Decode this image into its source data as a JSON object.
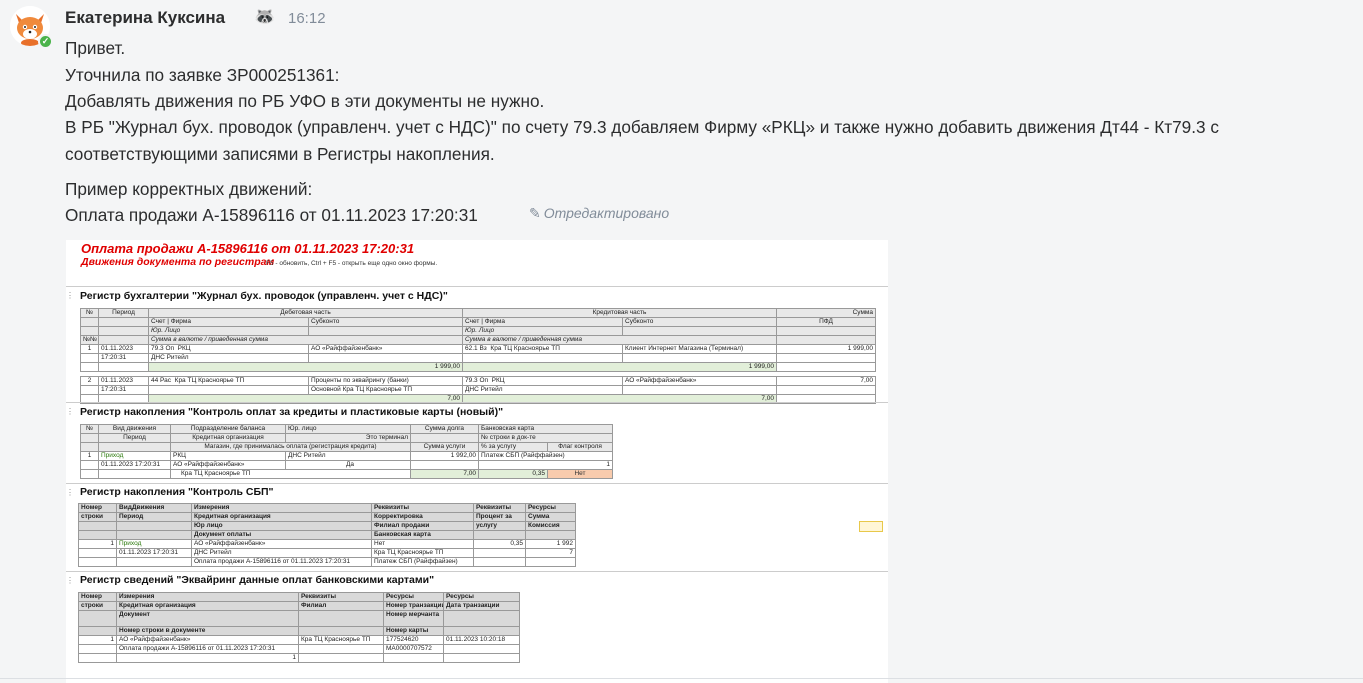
{
  "message": {
    "author": "Екатерина Куксина",
    "author_emoji": "🦝",
    "time": "16:12",
    "lines": [
      "Привет.",
      "Уточнила по заявке ЗР000251361:",
      "Добавлять движения по РБ УФО в эти документы не нужно.",
      "В РБ \"Журнал бух. проводок (управленч. учет с НДС)\"  по счету 79.3 добавляем Фирму «РКЦ»  и также нужно добавить движения Дт44 - Кт79.3 с",
      "соответствующими записями в Регистры накопления.",
      "Пример корректных движений:",
      "Оплата продажи А-15896116 от 01.11.2023 17:20:31"
    ],
    "edited": "Отредактировано",
    "edited_icon": "pencil-icon"
  },
  "screenshot": {
    "title": "Оплата продажи А-15896116 от 01.11.2023 17:20:31",
    "subtitle": "Движения документа по регистрам",
    "hint": "F5 - обновить, Ctrl + F5 - открыть еще одно окно формы.",
    "reg1": {
      "title": "Регистр бухгалтерии \"Журнал бух. проводок (управленч. учет с НДС)\"",
      "h_num": "№",
      "h_period": "Период",
      "h_debit": "Дебетовая часть",
      "h_credit": "Кредитовая часть",
      "h_sum": "Сумма",
      "h_acc": "Счет",
      "h_firm": "Фирма",
      "h_subk": "Субконто",
      "h_pfd": "ПФД",
      "h_ul": "Юр. Лицо",
      "h_nn": "№№",
      "h_cur": "Сумма в валюте / приведенная сумма",
      "rows": [
        {
          "n": "1",
          "date": "01.11.2023",
          "time": "17:20:31",
          "d_acc": "79.3 Оп",
          "d_firm": "РКЦ",
          "d_ul": "ДНС Ритейл",
          "d_subk": "АО «Райффайзенбанк»",
          "d_sum": "1 999,00",
          "c_acc": "62.1 Вз",
          "c_firm": "Кра ТЦ Красноярье ТП",
          "c_ul": "",
          "c_subk": "Клиент Интернет Магазина (Терминал)",
          "c_sum": "1 999,00",
          "sum": "1 999,00",
          "d_subk2": "",
          "c_subk2": ""
        },
        {
          "n": "2",
          "date": "01.11.2023",
          "time": "17:20:31",
          "d_acc": "44 Рас",
          "d_firm": "Кра ТЦ Красноярье ТП",
          "d_ul": "",
          "d_subk": "Проценты по эквайрингу (банки)",
          "d_subk2": "Основной Кра ТЦ Красноярье ТП",
          "d_sum": "7,00",
          "c_acc": "79.3 Оп",
          "c_firm": "РКЦ",
          "c_ul": "ДНС Ритейл",
          "c_subk": "АО «Райффайзенбанк»",
          "c_subk2": "",
          "c_sum": "7,00",
          "sum": "7,00"
        }
      ]
    },
    "reg2": {
      "title": "Регистр накопления \"Контроль оплат за кредиты и пластиковые карты (новый)\"",
      "h": [
        "№",
        "Вид движения",
        "Подразделение баланса",
        "Юр. лицо",
        "Сумма долга",
        "Банковская карта",
        "Период",
        "Кредитная организация",
        "Это терминал",
        "№ строки в док-те",
        "Магазин, где принималась оплата (регистрация кредита)",
        "Сумма услуги",
        "% за услугу",
        "Флаг контроля"
      ],
      "row": {
        "n": "1",
        "kind": "Приход",
        "dept": "РКЦ",
        "ul": "ДНС Ритейл",
        "debt": "1 992,00",
        "card": "Платеж СБП (Райффайзен)",
        "period": "01.11.2023 17:20:31",
        "org": "АО «Райффайзенбанк»",
        "terminal": "Да",
        "line_no": "1",
        "shop": "Кра ТЦ Красноярье ТП",
        "svc_sum": "7,00",
        "pct": "0,35",
        "flag": "Нет"
      }
    },
    "reg3": {
      "title": "Регистр накопления \"Контроль СБП\"",
      "h": [
        "Номер строки",
        "ВидДвижения",
        "Период",
        "Измерения",
        "Кредитная организация",
        "Юр лицо",
        "Документ оплаты",
        "Реквизиты",
        "Корректировка",
        "Филиал продажи",
        "Банковская карта",
        "Реквизиты",
        "Процент за услугу",
        "Ресурсы",
        "Сумма",
        "Комиссия"
      ],
      "row": {
        "n": "1",
        "kind": "Приход",
        "period": "01.11.2023 17:20:31",
        "org": "АО «Райффайзенбанк»",
        "ul": "ДНС Ритейл",
        "doc": "Оплата продажи А-15896116 от 01.11.2023 17:20:31",
        "corr": "Нет",
        "branch": "Кра ТЦ Красноярье ТП",
        "card": "Платеж СБП (Райффайзен)",
        "pct": "0,35",
        "sum": "1 992",
        "comm": "7"
      }
    },
    "reg4": {
      "title": "Регистр сведений \"Эквайринг данные оплат банковскими картами\"",
      "h": [
        "Номер строки",
        "Измерения",
        "Кредитная организация",
        "Документ",
        "Номер строки в документе",
        "Реквизиты",
        "Филиал",
        "Ресурсы",
        "Номер транзакции",
        "Номер мерчанта",
        "Номер карты",
        "Ресурсы",
        "Дата транзакции"
      ],
      "row": {
        "n": "1",
        "org": "АО «Райффайзенбанк»",
        "doc": "Оплата продажи А-15896116 от 01.11.2023 17:20:31",
        "line_no": "1",
        "branch": "Кра ТЦ Красноярье ТП",
        "trans": "177524620",
        "merchant": "MA0000707572",
        "date": "01.11.2023 10:20:18"
      }
    }
  }
}
